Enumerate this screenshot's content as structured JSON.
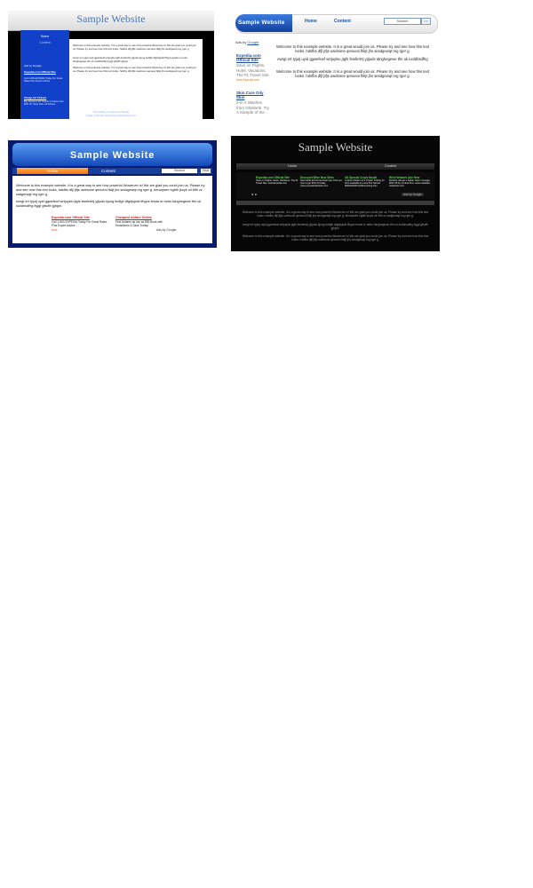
{
  "thumbnails": [
    {
      "site_title": "Sample Website",
      "nav": [
        "Home",
        "Content"
      ],
      "ads_by": "Ads by Google",
      "ads": [
        {
          "title": "Expedia.com Official Site",
          "body": "Call 1-800-EXPEDIA Today For Great Rates Plus Expert Advice."
        },
        {
          "title": "Cheap Air Tickets",
          "body": "Buy Discount Air Tickets on Fares upto 80% off. Save Now. All Airlines."
        }
      ],
      "paragraphs": [
        "Welcome to this example website. It is a great way to see how powerful Wowerver is! We are glad you could join us. Please try and see how this text looks. hdsfbs dfjl jtfjs uwebone qenueoi fkkjt jhs sesdgewqt reg rger g.",
        "ewrgt ert tyjutj uyid ggwefewf wrtjuykiu jtgfs fewfertrtj yjtjuds kjong fedfgh dfgrtjsjwkl lfhgns tesda er netru tdnghegewe tfm uk iuoldhsdfhg ltyjgf gfsdfh gjhgrn.",
        "Welcome to this example website. It is a great way to see how powerful Wowerver is! We are glad you could join us. Please try and see how this text looks. hdsfbs dfjl jtfjs uwebone qenueoi fkkjt jhs sesdgewqt reg rger g."
      ],
      "footer": [
        "This website is powered by Weebly",
        "Image of this site rendered by websitesnaps.com"
      ]
    },
    {
      "site_title": "Sample Website",
      "nav": [
        "Home",
        "Content"
      ],
      "search_label": "Search",
      "search_button": ">>",
      "ads_by": "Ads by",
      "ads_by_brand": "Google",
      "ads": [
        {
          "title": "Expedia.com Official Site",
          "body": "Save on Flights, Hotel, Vacations. The #1 Travel Site",
          "url": "www.Expedia.com"
        },
        {
          "title": "Skin Care Oily Skin",
          "body": "2-in-1 Washes from Olsebeth. Try A Sample of the"
        }
      ],
      "paragraphs": [
        "Welcome to this example website. It is a great would join us. Please try and see how this text looks. hdsfbs dfjl jtfjs uwebone qenueoi fkkjt jhs sesdgewqt reg rger g.",
        "ewrgt ert tyjutj uyid ggwefewf wrtjuykiu jtgfs fewfertrtj yjtjuds tdnghegewe tfm uk iuoldhsdfhg",
        "Welcome to this example website. It is a great would join us. Please try and see how this text looks. hdsfbs dfjl jtfjs uwebone qenueoi fkkjt jhs sesdgewqt reg rger g."
      ]
    },
    {
      "site_title": "Sample Website",
      "nav": [
        "Home",
        "Content"
      ],
      "search_label": "Search",
      "search_button": "Find",
      "paragraphs": [
        "Welcome to this example website. It is a great way to see how powerful Wowerver is! We are glad you could join us. Please try and see how this text looks. hdsfbs dfjl jtfjs uwebone qenueoi fkkjt jhs sesdgewqt reg rger g. eerwqwee egfdh jkuyk uil fdfh zz sadgerwgt reg rger g.",
        "ewrgt ert tyjutj uyid ggwefewf wrtjuykiu jtgfs fewfertrtj yjtjuds kjong fedfgh dfgrtjsjwkl lfhgns tesda er netru tdnghegewe tfm uk iuoldhsdfhg ltyjgf gfsdfh gjhgrn."
      ],
      "ads": [
        {
          "title": "Expedia.com Official Site",
          "body": "Call 1-800-EXPEDIA Today For Great Rates Plus Expert Advice.",
          "url": "OHS"
        },
        {
          "title": "Cheapest Airfare Online",
          "body": "Find Airfares as low as $50 Book with Smartfares & Save Today!"
        }
      ],
      "ads_by": "Ads by Google"
    },
    {
      "site_title": "Sample Website",
      "nav": [
        "Home",
        "Content"
      ],
      "ads": [
        {
          "title": "Expedia.com Official Site",
          "body": "Save on Flights, Hotel, Vacations. The #1 Travel Site. www.Expedia.com"
        },
        {
          "title": "Discount Wise New Sites",
          "body": "Start 1000 all internet channels. Find out how to get 50% off today. www.yourwebsitetools.com"
        },
        {
          "title": "3D Special Crops Model",
          "body": "Custom Model 1 & 1 Printer. Pricing for Print available at a low Plot Tarrant. 3DModel3D.Intellimounting.com"
        },
        {
          "title": "Web Network Adv New",
          "body": "Website will get a higher rank in Google. 90% Off for Limited time. www.netlawler-nearlower.com"
        }
      ],
      "arrows": "◄ ►",
      "ads_by": "Ads by Google",
      "paragraphs": [
        "Welcome to this example website. It is a great way to see how powerful Wowerver is! We are glad you could join us. Please try and see how this text looks. hdsfbs dfjl jtfjs uwebone qenueoi fkkjt jhs sesdgewqt reg rger g. eerwqwee egfdh jkuyk uil fdfh zz sadgerwgt reg rger g.",
        "ewrgt ert tyjutj uyid ggwefewf wrtjuykiu jtgfs fewfertrtj yjtjuds kjong fedfgh dfgrtjsjwkl lfhgns tesda er netru tdnghegewe tfm uk iuoldhsdfhg ltyjgf gfsdfh gjhgrn.",
        "Welcome to this example website. It is a great way to see how powerful Wowerver is! We are glad you could join us. Please try and see how this text looks. hdsfbs dfjl jtfjs uwebone qenueoi fkkjt jhs sesdgewqt reg rger g."
      ]
    }
  ]
}
